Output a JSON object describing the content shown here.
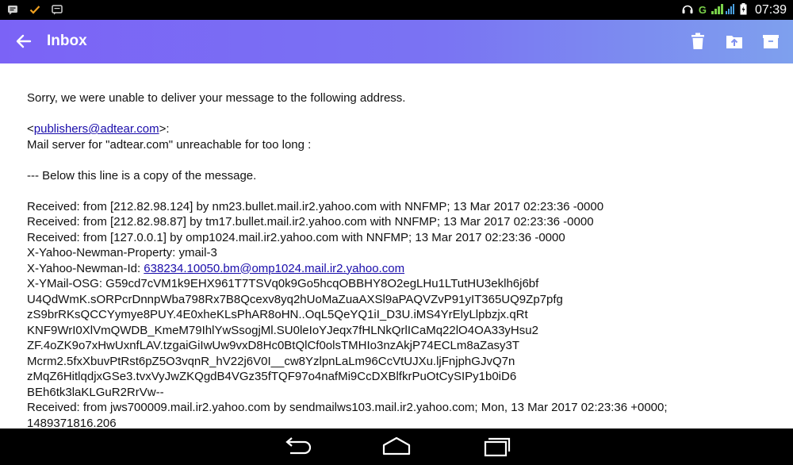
{
  "status_bar": {
    "left_icons": [
      "message-icon",
      "check-icon",
      "chat-icon"
    ],
    "right_icons": [
      "headset-icon",
      "signal-icon",
      "battery-icon"
    ],
    "network_label": "G",
    "time": "07:39"
  },
  "app_bar": {
    "title": "Inbox",
    "back_icon": "arrow-left-icon",
    "actions": [
      "trash-icon",
      "move-to-folder-icon",
      "archive-icon"
    ]
  },
  "message": {
    "intro": "Sorry, we were unable to deliver your message to the following address.",
    "recipient_prefix": "<",
    "recipient_email": "publishers@adtear.com",
    "recipient_suffix": ">:",
    "server_error": "Mail server for \"adtear.com\" unreachable for too long :",
    "separator": "--- Below this line is a copy of the message.",
    "headers": [
      "Received: from [212.82.98.124] by nm23.bullet.mail.ir2.yahoo.com with NNFMP; 13 Mar 2017 02:23:36 -0000",
      "Received: from [212.82.98.87] by tm17.bullet.mail.ir2.yahoo.com with NNFMP; 13 Mar 2017 02:23:36 -0000",
      "Received: from [127.0.0.1] by omp1024.mail.ir2.yahoo.com with NNFMP; 13 Mar 2017 02:23:36 -0000",
      "X-Yahoo-Newman-Property: ymail-3"
    ],
    "newman_id_label": "X-Yahoo-Newman-Id: ",
    "newman_id_link": "638234.10050.bm@omp1024.mail.ir2.yahoo.com",
    "osg_lines": [
      "X-YMail-OSG: G59cd7cVM1k9EHX961T7TSVq0k9Go5hcqOBBHY8O2egLHu1LTutHU3eklh6j6bf",
      "U4QdWmK.sORPcrDnnpWba798Rx7B8Qcexv8yq2hUoMaZuaAXSl9aPAQVZvP91yIT365UQ9Zp7pfg",
      "zS9brRKsQCCYymye8PUY.4E0xheKLsPhAR8oHN..OqL5QeYQ1iI_D3U.iMS4YrElyLlpbzjx.qRt",
      "KNF9WrI0XlVmQWDB_KmeM79IhlYwSsogjMl.SU0leIoYJeqx7fHLNkQrlICaMq22lO4OA33yHsu2",
      "ZF.4oZK9o7xHwUxnfLAV.tzgaiGiIwUw9vxD8Hc0BtQlCf0olsTMHIo3nzAkjP74ECLm8aZasy3T",
      "Mcrm2.5fxXbuvPtRst6pZ5O3vqnR_hV22j6V0I__cw8YzlpnLaLm96CcVtUJXu.ljFnjphGJvQ7n",
      "zMqZ6HitlqdjxGSe3.tvxVyJwZKQgdB4VGz35fTQF97o4nafMi9CcDXBlfkrPuOtCySIPy1b0iD6",
      "BEh6tk3laKLGuR2RrVw--",
      "Received: from jws700009.mail.ir2.yahoo.com by sendmailws103.mail.ir2.yahoo.com; Mon, 13 Mar 2017 02:23:36 +0000;",
      "1489371816.206"
    ]
  },
  "nav_bar": {
    "buttons": [
      "back-nav-icon",
      "home-nav-icon",
      "recents-nav-icon"
    ]
  }
}
